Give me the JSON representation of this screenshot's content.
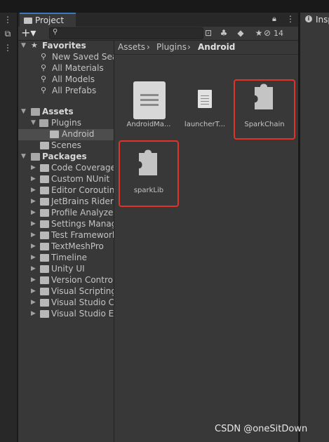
{
  "left_strip": {
    "menu_icon": "kebab-menu-icon",
    "hierarchy_icon": "hierarchy-icon"
  },
  "project_tab": {
    "title": "Project",
    "lock_icon": "lock-icon",
    "menu_icon": "kebab-menu-icon"
  },
  "toolbar": {
    "add_label": "+▾",
    "search": {
      "value": "",
      "placeholder": ""
    },
    "hidden_count": "14"
  },
  "favorites": {
    "label": "Favorites",
    "items": [
      "New Saved Sea",
      "All Materials",
      "All Models",
      "All Prefabs"
    ]
  },
  "assets": {
    "label": "Assets",
    "plugins": "Plugins",
    "android": "Android",
    "scenes": "Scenes"
  },
  "packages": {
    "label": "Packages",
    "items": [
      "Code Coverage",
      "Custom NUnit",
      "Editor Coroutine",
      "JetBrains Rider",
      "Profile Analyzer",
      "Settings Manag",
      "Test Framework",
      "TextMeshPro",
      "Timeline",
      "Unity UI",
      "Version Control",
      "Visual Scripting",
      "Visual Studio Co",
      "Visual Studio Ed"
    ]
  },
  "breadcrumb": {
    "assets": "Assets",
    "sep1": "›",
    "plugins": "Plugins",
    "sep2": "›",
    "android": "Android"
  },
  "content_assets": [
    {
      "name": "AndroidMa...",
      "icon": "manifest-document-icon"
    },
    {
      "name": "launcherT...",
      "icon": "text-document-icon"
    },
    {
      "name": "SparkChain",
      "icon": "plugin-puzzle-icon",
      "highlighted": true
    },
    {
      "name": "sparkLib",
      "icon": "plugin-puzzle-icon",
      "highlighted": true
    }
  ],
  "inspector_tab": {
    "title": "Insp"
  },
  "watermark": "CSDN @oneSitDown",
  "colors": {
    "selection": "#4d4d4d",
    "highlight_box": "#e2332a",
    "panel_bg": "#383838",
    "tab_accent": "#3a79bb"
  }
}
